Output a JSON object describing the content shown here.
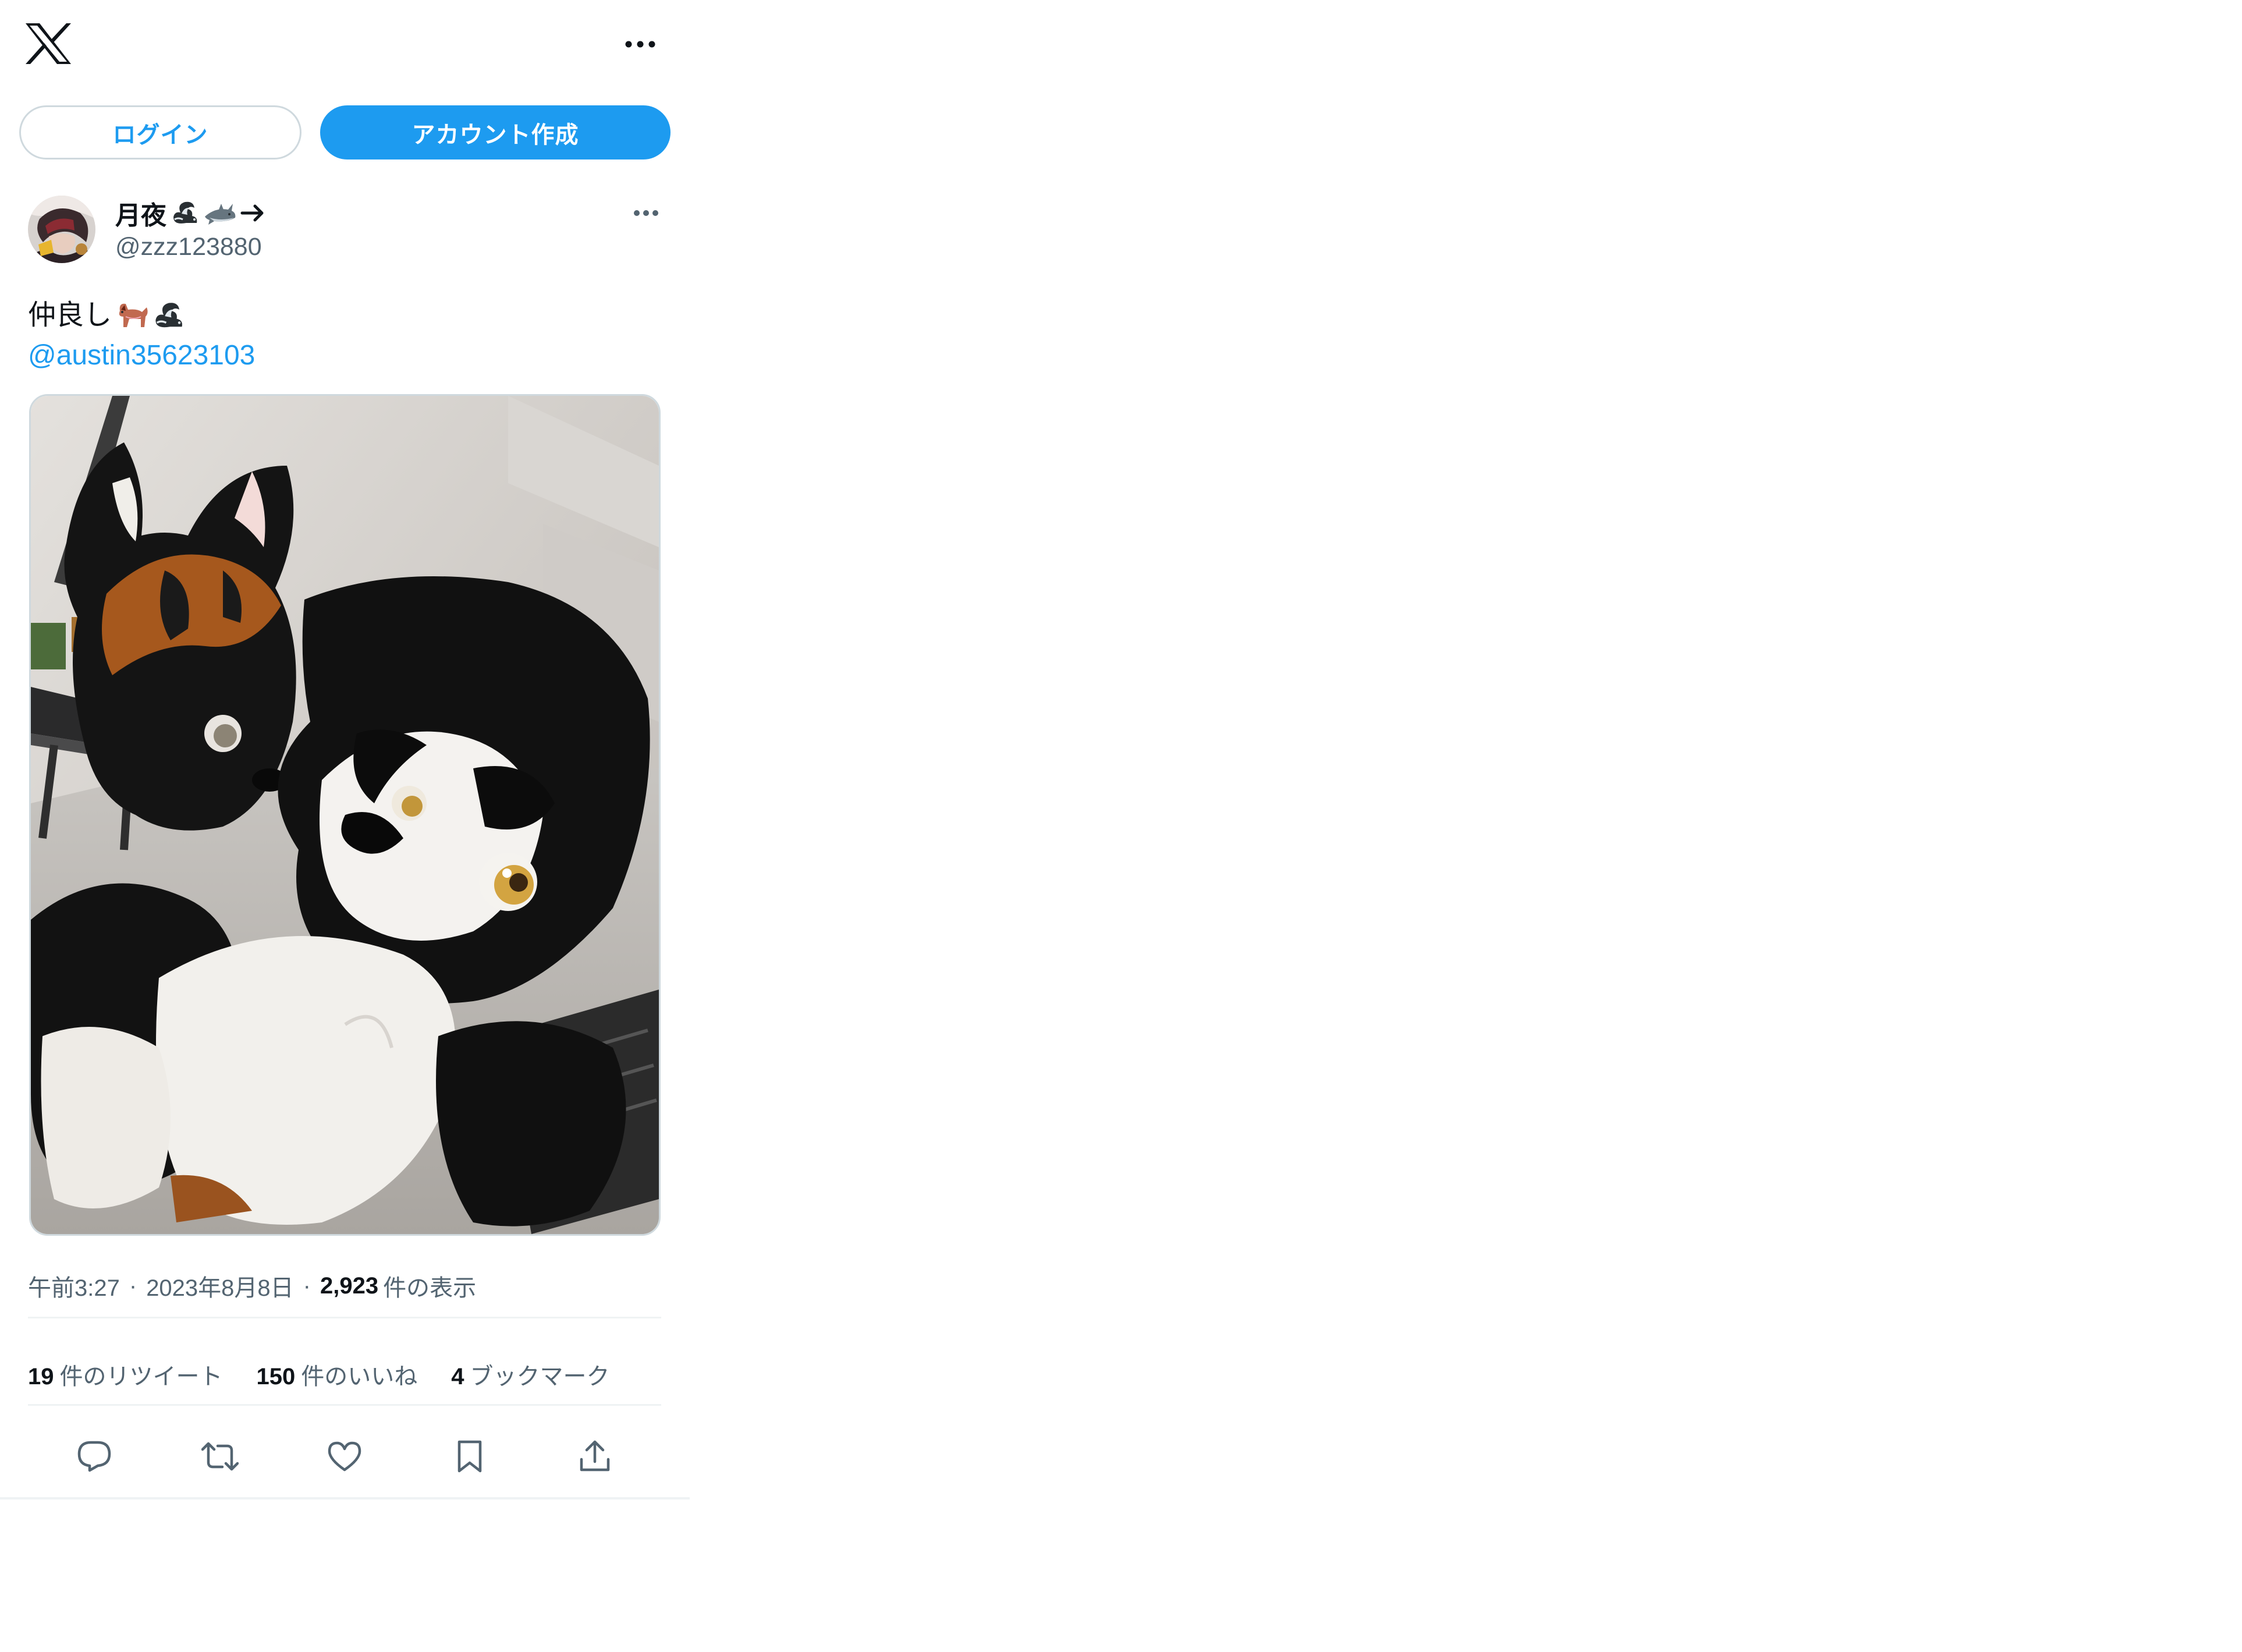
{
  "header": {
    "logo_icon": "x-logo-icon",
    "more_icon": "more-horizontal-icon",
    "login_label": "ログイン",
    "signup_label": "アカウント作成"
  },
  "post": {
    "author": {
      "display_name": "月夜",
      "name_emojis": [
        "skunk-emoji",
        "shark-emoji",
        "→"
      ],
      "handle": "@zzz123880"
    },
    "text": "仲良し",
    "text_emojis": [
      "dog-emoji",
      "skunk-emoji"
    ],
    "mention": "@austin35623103",
    "photo_icon": "post-photo",
    "time": "午前3:27",
    "date": "2023年8月8日",
    "separator": "·",
    "views_count": "2,923",
    "views_label": "件の表示",
    "stats": {
      "retweets_count": "19",
      "retweets_label": "件のリツイート",
      "likes_count": "150",
      "likes_label": "件のいいね",
      "bookmarks_count": "4",
      "bookmarks_label": "ブックマーク"
    },
    "actions": [
      "reply-icon",
      "retweet-icon",
      "like-icon",
      "bookmark-icon",
      "share-icon"
    ]
  },
  "colors": {
    "accent": "#1d9bf0",
    "text": "#0f1419",
    "secondary": "#536471",
    "border": "#cfd9de",
    "divider": "#eff3f4"
  }
}
